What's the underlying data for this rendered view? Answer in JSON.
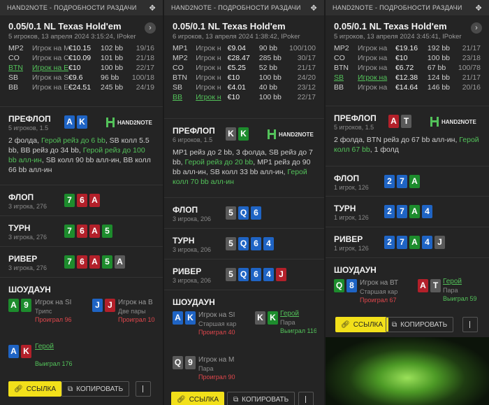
{
  "app_title": "HAND2NOTE - ПОДРОБНОСТИ РАЗДАЧИ",
  "labels": {
    "preflop": "ПРЕФЛОП",
    "flop": "ФЛОП",
    "turn": "ТУРН",
    "river": "РИВЕР",
    "showdown": "ШОУДАУН",
    "link_btn": "ССЫЛКА",
    "copy_btn": "КОПИРОВАТЬ",
    "logo": "HAND2NOTE"
  },
  "hands": [
    {
      "stake": "0.05/0.1 NL Texas Hold'em",
      "meta": "5 игроков, 13 апреля 2024 3:15:24, IPoker",
      "players": [
        {
          "pos": "MP2",
          "name": "Игрок на М",
          "stack": "€10.15",
          "bb": "102 bb",
          "ns": "19/16"
        },
        {
          "pos": "CO",
          "name": "Игрок на С",
          "stack": "€10.09",
          "bb": "101 bb",
          "ns": "21/18"
        },
        {
          "pos": "BTN",
          "name": "Игрок на Е",
          "stack": "€10",
          "bb": "100 bb",
          "ns": "22/17"
        },
        {
          "pos": "SB",
          "name": "Игрок на S",
          "stack": "€9.6",
          "bb": "96 bb",
          "ns": "100/18"
        },
        {
          "pos": "BB",
          "name": "Игрок на Е",
          "stack": "€24.51",
          "bb": "245 bb",
          "ns": "24/19"
        }
      ],
      "preflop": {
        "sub": "5 игроков, 1.5",
        "cards": [
          "A",
          "K"
        ],
        "a1": "2 фолда, ",
        "h1": "Герой рейз до 6 bb",
        "a2": ", SB колл 5.5 bb, BB рейз до 34 bb, ",
        "h2": "Герой рейз до 100 bb алл-ин",
        "a3": ", SB колл 90 bb алл-ин, BB колл 66 bb алл-ин"
      },
      "flop": {
        "sub": "3 игрока, 276",
        "cards": [
          "7",
          "6",
          "A"
        ]
      },
      "turn": {
        "sub": "3 игрока, 276",
        "cards": [
          "7",
          "6",
          "A",
          "5"
        ]
      },
      "river": {
        "sub": "3 игрока, 276",
        "cards": [
          "7",
          "6",
          "A",
          "5",
          "A"
        ]
      },
      "showdown": [
        {
          "cards": [
            "A",
            "9"
          ],
          "name": "Игрок на SI",
          "desc": "Трипс",
          "result": "Проиграл 96"
        },
        {
          "cards": [
            "J",
            "J"
          ],
          "name": "Игрок на В",
          "desc": "Две пары",
          "result": "Проиграл 10"
        },
        {
          "cards": [
            "A",
            "K"
          ],
          "name": "Герой",
          "desc": "",
          "result": "Выиграл 176"
        }
      ]
    },
    {
      "stake": "0.05/0.1 NL Texas Hold'em",
      "meta": "6 игроков, 13 апреля 2024 1:38:42, IPoker",
      "players": [
        {
          "pos": "MP1",
          "name": "Игрок н",
          "stack": "€9.04",
          "bb": "90 bb",
          "ns": "100/100"
        },
        {
          "pos": "MP2",
          "name": "Игрок н",
          "stack": "€28.47",
          "bb": "285 bb",
          "ns": "30/17"
        },
        {
          "pos": "CO",
          "name": "Игрок н",
          "stack": "€5.25",
          "bb": "52 bb",
          "ns": "21/17"
        },
        {
          "pos": "BTN",
          "name": "Игрок н",
          "stack": "€10",
          "bb": "100 bb",
          "ns": "24/20"
        },
        {
          "pos": "SB",
          "name": "Игрок н",
          "stack": "€4.01",
          "bb": "40 bb",
          "ns": "23/12"
        },
        {
          "pos": "BB",
          "name": "Игрок н",
          "stack": "€10",
          "bb": "100 bb",
          "ns": "22/17"
        }
      ],
      "preflop": {
        "sub": "6 игроков, 1.5",
        "cards": [
          "K",
          "K"
        ],
        "a1": "MP1 рейз до 2 bb, 3 фолда, SB рейз до 7 bb, ",
        "h1": "Герой рейз до 20 bb",
        "a2": ", MP1 рейз до 90 bb алл-ин, SB колл 33 bb алл-ин, ",
        "h2": "Герой колл 70 bb алл-ин",
        "a3": ""
      },
      "flop": {
        "sub": "3 игрока, 206",
        "cards": [
          "5",
          "Q",
          "6"
        ]
      },
      "turn": {
        "sub": "3 игрока, 206",
        "cards": [
          "5",
          "Q",
          "6",
          "4"
        ]
      },
      "river": {
        "sub": "3 игрока, 206",
        "cards": [
          "5",
          "Q",
          "6",
          "4",
          "J"
        ]
      },
      "showdown": [
        {
          "cards": [
            "A",
            "K"
          ],
          "name": "Игрок на SI",
          "desc": "Старшая кар",
          "result": "Проиграл 40"
        },
        {
          "cards": [
            "K",
            "K"
          ],
          "name": "Герой",
          "desc": "Пара",
          "result": "Выиграл 116"
        },
        {
          "cards": [
            "Q",
            "9"
          ],
          "name": "Игрок на М",
          "desc": "Пара",
          "result": "Проиграл 90"
        }
      ]
    },
    {
      "stake": "0.05/0.1 NL Texas Hold'em",
      "meta": "5 игроков, 13 апреля 2024 3:45:41, IPoker",
      "players": [
        {
          "pos": "MP2",
          "name": "Игрок на",
          "stack": "€19.16",
          "bb": "192 bb",
          "ns": "21/17"
        },
        {
          "pos": "CO",
          "name": "Игрок на",
          "stack": "€10",
          "bb": "100 bb",
          "ns": "23/18"
        },
        {
          "pos": "BTN",
          "name": "Игрок на",
          "stack": "€6.72",
          "bb": "67 bb",
          "ns": "100/78"
        },
        {
          "pos": "SB",
          "name": "Игрок на",
          "stack": "€12.38",
          "bb": "124 bb",
          "ns": "21/17"
        },
        {
          "pos": "BB",
          "name": "Игрок на",
          "stack": "€14.64",
          "bb": "146 bb",
          "ns": "20/16"
        }
      ],
      "preflop": {
        "sub": "5 игроков, 1.5",
        "cards": [
          "A",
          "T"
        ],
        "a1": "2 фолда, BTN рейз до 67 bb алл-ин, ",
        "h1": "Герой колл 67 bb",
        "a2": ", 1 фолд",
        "h2": "",
        "a3": ""
      },
      "flop": {
        "sub": "1 игрок, 126",
        "cards": [
          "2",
          "7",
          "A"
        ]
      },
      "turn": {
        "sub": "1 игрок, 126",
        "cards": [
          "2",
          "7",
          "A",
          "4"
        ]
      },
      "river": {
        "sub": "1 игрок, 126",
        "cards": [
          "2",
          "7",
          "A",
          "4",
          "J"
        ]
      },
      "showdown": [
        {
          "cards": [
            "Q",
            "8"
          ],
          "name": "Игрок на ВТ",
          "desc": "Старшая кар",
          "result": "Проиграл 67"
        },
        {
          "cards": [
            "A",
            "T"
          ],
          "name": "Герой",
          "desc": "Пара",
          "result": "Выиграл 59"
        }
      ]
    }
  ],
  "colors": {
    "hero": "#53c25a",
    "win": "#53c25a",
    "loss": "#e0474c",
    "link_btn": "#f2e01a",
    "clubs": "#1d8c2d",
    "diamonds": "#1f64c4",
    "hearts": "#b3202a",
    "spades": "#5a5a5a"
  }
}
